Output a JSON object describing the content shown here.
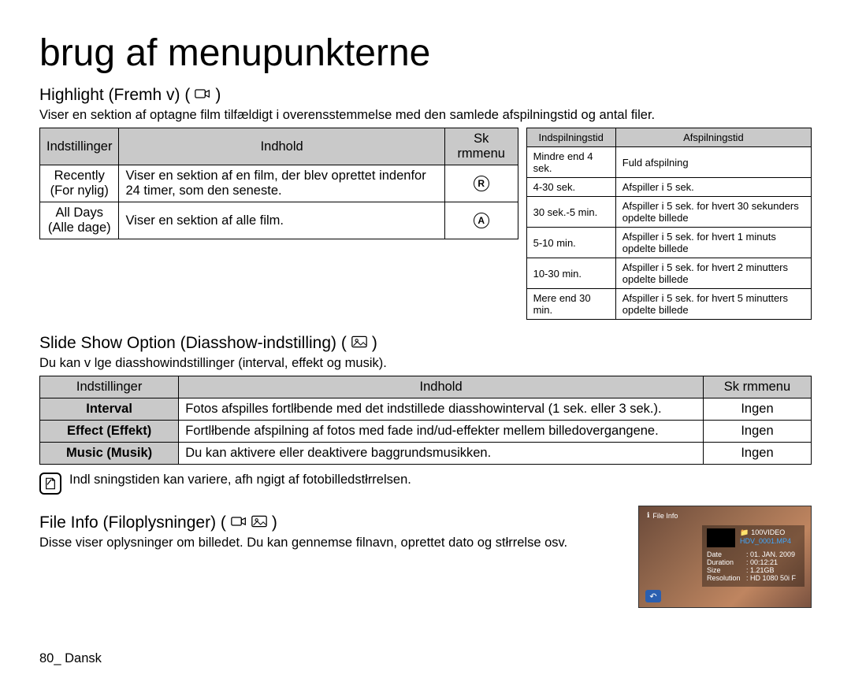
{
  "page_title": "brug af menupunkterne",
  "footer": "80_ Dansk",
  "highlight": {
    "heading": "Highlight (Fremh v) (",
    "heading_close": ")",
    "desc": "Viser en sektion af optagne film tilfældigt i overensstemmelse med den samlede afspilningstid og antal filer.",
    "head1": "Indstillinger",
    "head2": "Indhold",
    "head3": "Sk rmmenu",
    "row1_opt": "Recently\n(For nylig)",
    "row1_desc": "Viser en sektion af en film, der blev oprettet indenfor 24 timer, som den seneste.",
    "row1_icon": "R",
    "row2_opt": "All Days\n(Alle dage)",
    "row2_desc": "Viser en sektion af alle film.",
    "row2_icon": "A"
  },
  "timing": {
    "head1": "Indspilningstid",
    "head2": "Afspilningstid",
    "rows": [
      {
        "rec": "Mindre end 4 sek.",
        "play": "Fuld afspilning"
      },
      {
        "rec": "4-30 sek.",
        "play": "Afspiller i 5 sek."
      },
      {
        "rec": "30 sek.-5 min.",
        "play": "Afspiller i 5 sek. for hvert 30 sekunders opdelte billede"
      },
      {
        "rec": "5-10 min.",
        "play": "Afspiller i 5 sek. for hvert 1 minuts opdelte billede"
      },
      {
        "rec": "10-30 min.",
        "play": "Afspiller i 5 sek. for hvert 2 minutters opdelte billede"
      },
      {
        "rec": "Mere end 30 min.",
        "play": "Afspiller i 5 sek. for hvert 5 minutters opdelte billede"
      }
    ]
  },
  "slideshow": {
    "heading": "Slide Show Option (Diasshow-indstilling) (",
    "heading_close": ")",
    "desc": "Du kan v lge diasshowindstillinger (interval, effekt og musik).",
    "head1": "Indstillinger",
    "head2": "Indhold",
    "head3": "Sk rmmenu",
    "row1_opt": "Interval",
    "row1_desc": "Fotos afspilles fortlłbende med det indstillede diasshowinterval (1 sek. eller 3 sek.).",
    "row1_menu": "Ingen",
    "row2_opt": "Effect (Effekt)",
    "row2_desc": "Fortlłbende afspilning af fotos med fade ind/ud-effekter mellem billedovergangene.",
    "row2_menu": "Ingen",
    "row3_opt": "Music (Musik)",
    "row3_desc": "Du kan aktivere eller deaktivere baggrundsmusikken.",
    "row3_menu": "Ingen",
    "note": "Indl sningstiden kan variere, afh ngigt af fotobilledstłrrelsen."
  },
  "fileinfo": {
    "heading": "File Info (Filoplysninger) (",
    "heading_close": ")",
    "desc": "Disse viser oplysninger om billedet. Du kan gennemse filnavn, oprettet dato og stłrrelse osv.",
    "box_title": "File Info",
    "folder": "100VIDEO",
    "file": "HDV_0001.MP4",
    "date_label": "Date",
    "date": ": 01. JAN. 2009",
    "dur_label": "Duration",
    "dur": ": 00:12:21",
    "size_label": "Size",
    "size": ": 1.21GB",
    "res_label": "Resolution",
    "res": ": HD 1080 50i F"
  }
}
